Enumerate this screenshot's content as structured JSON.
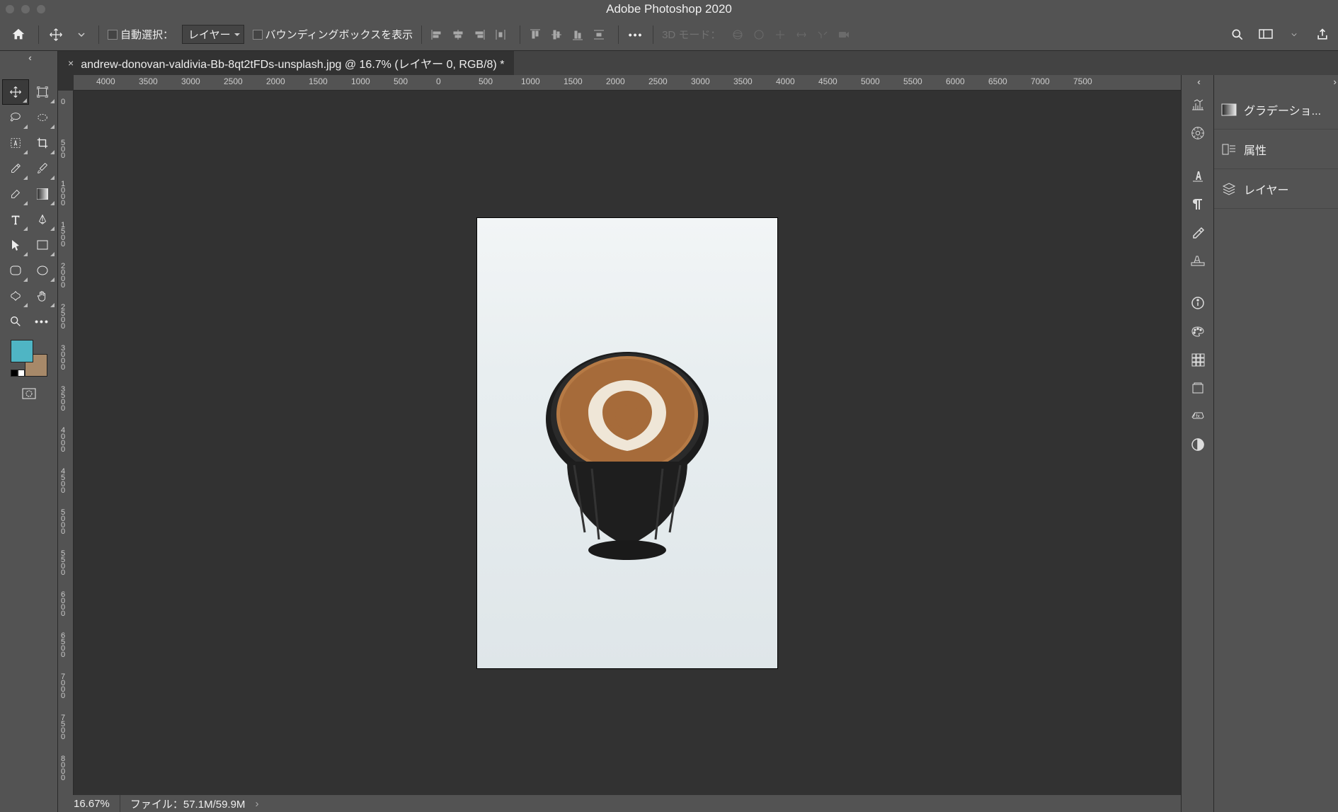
{
  "app": {
    "title": "Adobe Photoshop 2020"
  },
  "options": {
    "auto_select_label": "自動選択：",
    "layer_dd": "レイヤー",
    "bbox_label": "バウンディングボックスを表示",
    "mode3d_label": "3D モード："
  },
  "document": {
    "tab": "andrew-donovan-valdivia-Bb-8qt2tFDs-unsplash.jpg @ 16.7% (レイヤー 0, RGB/8) *"
  },
  "ruler_h": [
    "4000",
    "3500",
    "3000",
    "2500",
    "2000",
    "1500",
    "1000",
    "500",
    "0",
    "500",
    "1000",
    "1500",
    "2000",
    "2500",
    "3000",
    "3500",
    "4000",
    "4500",
    "5000",
    "5500",
    "6000",
    "6500",
    "7000",
    "7500"
  ],
  "ruler_v": [
    "0",
    "500",
    "1000",
    "1500",
    "2000",
    "2500",
    "3000",
    "3500",
    "4000",
    "4500",
    "5000",
    "5500",
    "6000",
    "6500",
    "7000",
    "7500",
    "8000"
  ],
  "tools": {
    "list": [
      "move",
      "artboard",
      "lasso",
      "quick-select",
      "object-select",
      "crop",
      "eyedropper",
      "brush",
      "eraser",
      "gradient",
      "type",
      "pen",
      "path-select",
      "shape-rect",
      "shape-ellipse",
      "shape-custom",
      "blur",
      "hand",
      "zoom",
      "more"
    ]
  },
  "swatch": {
    "fg": "#4fb5c4",
    "bg": "#a78969"
  },
  "right_collapsed_icons": [
    "adjust",
    "nav-wheel",
    "character",
    "paragraph",
    "utilities",
    "glyphs",
    "info",
    "swatches",
    "patterns",
    "libraries",
    "styles",
    "adjustments-circle"
  ],
  "right_dock": {
    "gradient": "グラデーショ...",
    "properties": "属性",
    "layers": "レイヤー"
  },
  "status": {
    "zoom": "16.67%",
    "file": "ファイル：57.1M/59.9M"
  }
}
